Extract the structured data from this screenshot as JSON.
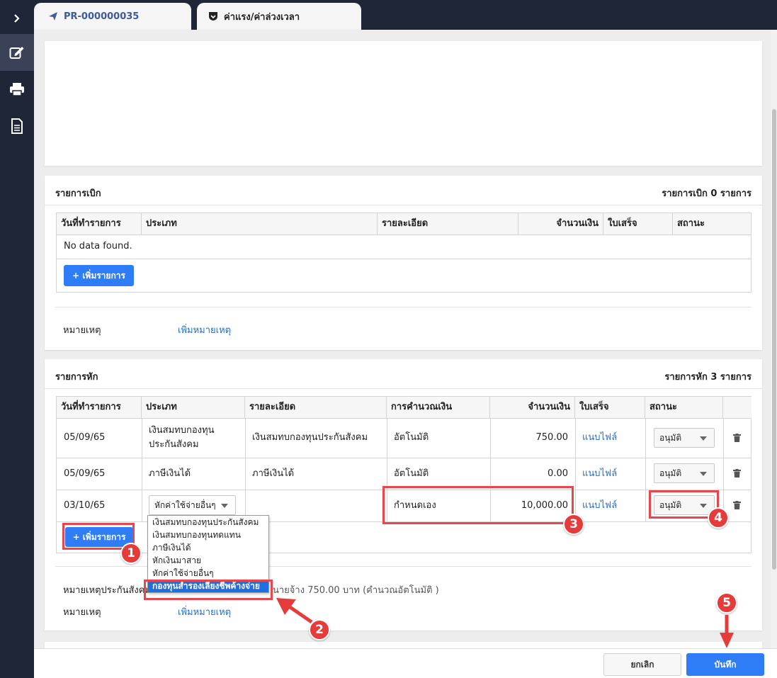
{
  "tabs": [
    {
      "label": "PR-000000035",
      "icon": "paper-plane-icon"
    },
    {
      "label": "ค่าแรง/ค่าล่วงเวลา",
      "icon": "shield-check-icon"
    }
  ],
  "sidebar": {
    "icons": [
      "chevron-right-icon",
      "edit-icon",
      "print-icon",
      "document-icon"
    ]
  },
  "withdraw": {
    "title": "รายการเบิก",
    "summary": "รายการเบิก 0 รายการ",
    "columns": [
      "วันที่ทำรายการ",
      "ประเภท",
      "รายละเอียด",
      "จำนวนเงิน",
      "ใบเสร็จ",
      "สถานะ"
    ],
    "empty_text": "No data found.",
    "add_button": "+ เพิ่มรายการ",
    "note_label": "หมายเหตุ",
    "note_link": "เพิ่มหมายเหตุ"
  },
  "deduct": {
    "title": "รายการหัก",
    "summary": "รายการหัก 3 รายการ",
    "columns": [
      "วันที่ทำรายการ",
      "ประเภท",
      "รายละเอียด",
      "การคำนวณเงิน",
      "จำนวนเงิน",
      "ใบเสร็จ",
      "สถานะ"
    ],
    "rows": [
      {
        "date": "05/09/65",
        "type": "เงินสมทบกองทุนประกันสังคม",
        "detail": "เงินสมทบกองทุนประกันสังคม",
        "calc": "อัตโนมัติ",
        "amount": "750.00",
        "receipt": "แนบไฟล์",
        "status": "อนุมัติ"
      },
      {
        "date": "05/09/65",
        "type": "ภาษีเงินได้",
        "detail": "ภาษีเงินได้",
        "calc": "อัตโนมัติ",
        "amount": "0.00",
        "receipt": "แนบไฟล์",
        "status": "อนุมัติ"
      },
      {
        "date": "03/10/65",
        "type": "หักค่าใช้จ่ายอื่นๆ",
        "detail": "",
        "calc": "กำหนดเอง",
        "amount": "10,000.00",
        "receipt": "แนบไฟล์",
        "status": "อนุมัติ"
      }
    ],
    "dropdown_options": [
      "เงินสมทบกองทุนประกันสังคม",
      "เงินสมทบกองทุนทดแทน",
      "ภาษีเงินได้",
      "หักเงินมาสาย",
      "หักค่าใช้จ่ายอื่นๆ",
      "กองทุนสำรองเลี้ยงชีพค้างจ่าย"
    ],
    "dropdown_highlighted": "กองทุนสำรองเลี้ยงชีพค้างจ่าย",
    "add_button": "+ เพิ่มรายการ",
    "sso_note_label": "หมายเหตุประกันสังคม",
    "sso_note_text": "นายจ้าง 750.00 บาท (คำนวณอัตโนมัติ )",
    "note_label": "หมายเหตุ",
    "note_link": "เพิ่มหมายเหตุ"
  },
  "footer": {
    "cancel": "ยกเลิก",
    "save": "บันทึก"
  },
  "annotations": [
    "1",
    "2",
    "3",
    "4",
    "5"
  ],
  "colors": {
    "sidebar_bg": "#1f2637",
    "primary": "#2e7cf6",
    "link": "#1f6fd1",
    "highlight": "#e6464c"
  }
}
